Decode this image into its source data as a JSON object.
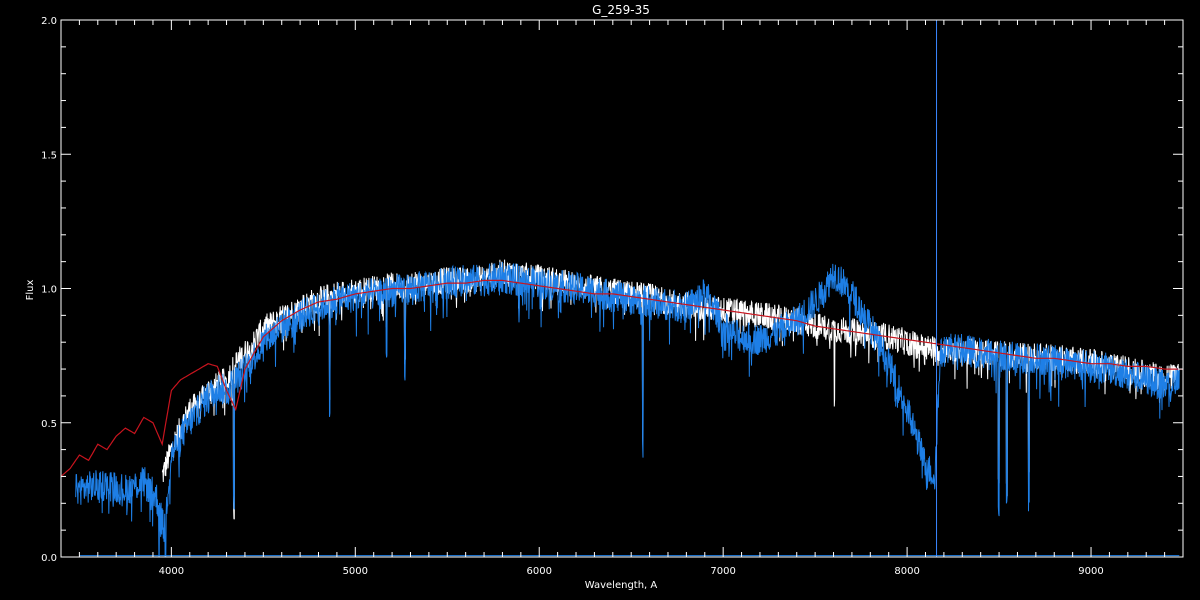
{
  "chart_data": {
    "type": "line",
    "title": "G_259-35",
    "xlabel": "Wavelength, A",
    "ylabel": "Flux",
    "xlim": [
      3400,
      9500
    ],
    "ylim": [
      0.0,
      2.0
    ],
    "xticks": [
      4000,
      5000,
      6000,
      7000,
      8000,
      9000
    ],
    "yticks": [
      0.0,
      0.5,
      1.0,
      1.5,
      2.0
    ],
    "ytick_labels": [
      "0.0",
      "0.5",
      "1.0",
      "1.5",
      "2.0"
    ],
    "grid": false,
    "background": "#000000",
    "axis_color": "#ffffff",
    "vertical_marker": {
      "x": 8160,
      "color": "#3a86ff"
    },
    "series": [
      {
        "color": "#ffffff",
        "x": [
          3950,
          4000,
          4050,
          4100,
          4150,
          4200,
          4250,
          4300,
          4350,
          4400,
          4450,
          4500,
          4600,
          4700,
          4800,
          4900,
          5000,
          5100,
          5200,
          5300,
          5400,
          5500,
          5600,
          5700,
          5800,
          5900,
          6000,
          6100,
          6200,
          6300,
          6400,
          6500,
          6600,
          6700,
          6800,
          6900,
          7000,
          7100,
          7200,
          7300,
          7400,
          7500,
          7600,
          7700,
          7800,
          7900,
          8000,
          8100,
          8200,
          8300,
          8400,
          8500,
          8600,
          8700,
          8800,
          8900,
          9000,
          9100,
          9200,
          9300,
          9400,
          9480
        ],
        "y": [
          0.3,
          0.4,
          0.48,
          0.55,
          0.57,
          0.62,
          0.64,
          0.66,
          0.72,
          0.76,
          0.8,
          0.85,
          0.89,
          0.93,
          0.96,
          0.98,
          0.99,
          1.0,
          1.01,
          1.01,
          1.02,
          1.03,
          1.03,
          1.04,
          1.06,
          1.05,
          1.04,
          1.03,
          1.01,
          1.0,
          0.99,
          0.98,
          0.97,
          0.95,
          0.94,
          0.93,
          0.92,
          0.91,
          0.9,
          0.89,
          0.88,
          0.86,
          0.85,
          0.84,
          0.83,
          0.82,
          0.8,
          0.78,
          0.77,
          0.77,
          0.76,
          0.76,
          0.75,
          0.75,
          0.74,
          0.74,
          0.73,
          0.71,
          0.7,
          0.68,
          0.67,
          0.67
        ],
        "noise": 0.05,
        "absorption": [
          [
            4340,
            0.55
          ],
          [
            4861,
            0.4
          ],
          [
            5170,
            0.12
          ],
          [
            5270,
            0.3
          ],
          [
            5890,
            0.1
          ],
          [
            6563,
            0.55
          ],
          [
            7605,
            0.25
          ],
          [
            8498,
            0.5
          ],
          [
            8542,
            0.5
          ],
          [
            8662,
            0.45
          ]
        ]
      },
      {
        "color": "#1e7fe6",
        "x": [
          3480,
          3550,
          3650,
          3750,
          3850,
          3920,
          3960,
          4000,
          4050,
          4100,
          4150,
          4200,
          4250,
          4300,
          4400,
          4500,
          4600,
          4700,
          4800,
          4900,
          5000,
          5100,
          5200,
          5300,
          5400,
          5500,
          5600,
          5700,
          5800,
          5900,
          6000,
          6100,
          6200,
          6300,
          6400,
          6500,
          6600,
          6700,
          6800,
          6900,
          6950,
          7000,
          7050,
          7100,
          7200,
          7300,
          7400,
          7500,
          7550,
          7600,
          7650,
          7700,
          7800,
          7900,
          8000,
          8050,
          8100,
          8150,
          8180,
          8220,
          8300,
          8400,
          8500,
          8600,
          8700,
          8800,
          8900,
          9000,
          9100,
          9200,
          9300,
          9400,
          9480
        ],
        "y": [
          0.25,
          0.26,
          0.27,
          0.25,
          0.28,
          0.22,
          0.1,
          0.38,
          0.45,
          0.5,
          0.55,
          0.6,
          0.63,
          0.62,
          0.7,
          0.8,
          0.86,
          0.9,
          0.93,
          0.96,
          0.97,
          0.98,
          0.99,
          1.0,
          1.01,
          1.02,
          1.03,
          1.03,
          1.04,
          1.03,
          1.02,
          1.01,
          1.0,
          0.99,
          0.97,
          0.96,
          0.95,
          0.94,
          0.93,
          0.98,
          0.93,
          0.86,
          0.83,
          0.82,
          0.81,
          0.84,
          0.88,
          0.95,
          0.99,
          1.06,
          1.02,
          0.98,
          0.86,
          0.72,
          0.55,
          0.45,
          0.34,
          0.3,
          0.75,
          0.78,
          0.77,
          0.76,
          0.75,
          0.74,
          0.74,
          0.73,
          0.72,
          0.71,
          0.7,
          0.68,
          0.66,
          0.64,
          0.65
        ],
        "noise": 0.06,
        "absorption": [
          [
            3933,
            0.3
          ],
          [
            3968,
            0.3
          ],
          [
            4340,
            0.45
          ],
          [
            4861,
            0.45
          ],
          [
            5170,
            0.2
          ],
          [
            5270,
            0.3
          ],
          [
            5890,
            0.1
          ],
          [
            6563,
            0.55
          ],
          [
            8498,
            0.55
          ],
          [
            8542,
            0.55
          ],
          [
            8662,
            0.5
          ]
        ]
      },
      {
        "color": "#c8141e",
        "x": [
          3400,
          3450,
          3500,
          3550,
          3600,
          3650,
          3700,
          3750,
          3800,
          3850,
          3900,
          3950,
          4000,
          4050,
          4100,
          4150,
          4200,
          4250,
          4300,
          4350,
          4400,
          4500,
          4600,
          4700,
          4800,
          4900,
          5000,
          5100,
          5200,
          5300,
          5400,
          5500,
          5600,
          5700,
          5800,
          5900,
          6000,
          6100,
          6200,
          6300,
          6400,
          6500,
          6600,
          6700,
          6800,
          6900,
          7000,
          7100,
          7200,
          7300,
          7400,
          7500,
          7600,
          7700,
          7800,
          7900,
          8000,
          8100,
          8200,
          8300,
          8400,
          8500,
          8600,
          8700,
          8800,
          8900,
          9000,
          9100,
          9200,
          9300,
          9400,
          9500
        ],
        "y": [
          0.3,
          0.33,
          0.38,
          0.36,
          0.42,
          0.4,
          0.45,
          0.48,
          0.46,
          0.52,
          0.5,
          0.42,
          0.62,
          0.66,
          0.68,
          0.7,
          0.72,
          0.71,
          0.62,
          0.55,
          0.7,
          0.82,
          0.88,
          0.92,
          0.95,
          0.96,
          0.98,
          0.99,
          1.0,
          1.0,
          1.01,
          1.02,
          1.02,
          1.03,
          1.03,
          1.02,
          1.01,
          1.0,
          0.99,
          0.98,
          0.98,
          0.97,
          0.96,
          0.95,
          0.94,
          0.93,
          0.92,
          0.91,
          0.9,
          0.89,
          0.88,
          0.86,
          0.85,
          0.84,
          0.83,
          0.82,
          0.81,
          0.8,
          0.79,
          0.78,
          0.77,
          0.76,
          0.75,
          0.74,
          0.74,
          0.73,
          0.72,
          0.72,
          0.71,
          0.71,
          0.7,
          0.7
        ],
        "noise": 0,
        "absorption": []
      }
    ]
  }
}
